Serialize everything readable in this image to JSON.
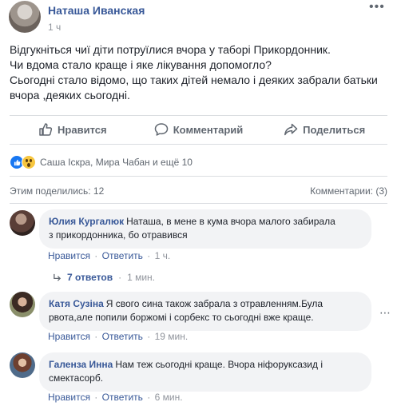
{
  "post": {
    "author": "Наташа Иванская",
    "time": "1 ч",
    "text_lines": [
      "Відгукніться чиї діти потруїлися вчора у таборі Прикордонник.",
      "Чи вдома стало краще і яке лікування допомогло?",
      "Сьогодні стало відомо, що таких дітей немало і деяких забрали батьки",
      "вчора ,деяких сьогодні."
    ]
  },
  "actions": {
    "like": "Нравится",
    "comment": "Комментарий",
    "share": "Поделиться"
  },
  "reactions": {
    "text": "Саша Іскра, Мира Чабан и ещё 10",
    "types": [
      "like-icon",
      "wow-icon"
    ],
    "colors": {
      "like": "#1877f2",
      "wow": "#f7c63f"
    }
  },
  "stats": {
    "shares": "Этим поделились: 12",
    "comments": "Комментарии: (3)"
  },
  "comments": [
    {
      "name": "Юлия Кургалюк",
      "lines": [
        "Наташа, в мене в кума вчора малого забирала",
        "з прикордонника, бо отравився"
      ],
      "like": "Нравится",
      "reply": "Ответить",
      "time": "1 ч."
    },
    {
      "name": "Катя Сузіна",
      "lines": [
        "Я свого сина також забрала з отравленням.Була",
        "рвота,але попили боржомі і сорбекс то сьогодні вже краще."
      ],
      "like": "Нравится",
      "reply": "Ответить",
      "time": "19 мин."
    },
    {
      "name": "Галенза Инна",
      "lines": [
        "Нам теж сьогодні краще. Вчора ніфоруксазид і",
        "смектасорб."
      ],
      "like": "Нравится",
      "reply": "Ответить",
      "time": "6 мин."
    }
  ],
  "replies": {
    "label": "7 ответов",
    "time": "1 мин."
  },
  "colors": {
    "link": "#385898",
    "secondary": "#606770",
    "bubble": "#f2f3f5"
  }
}
